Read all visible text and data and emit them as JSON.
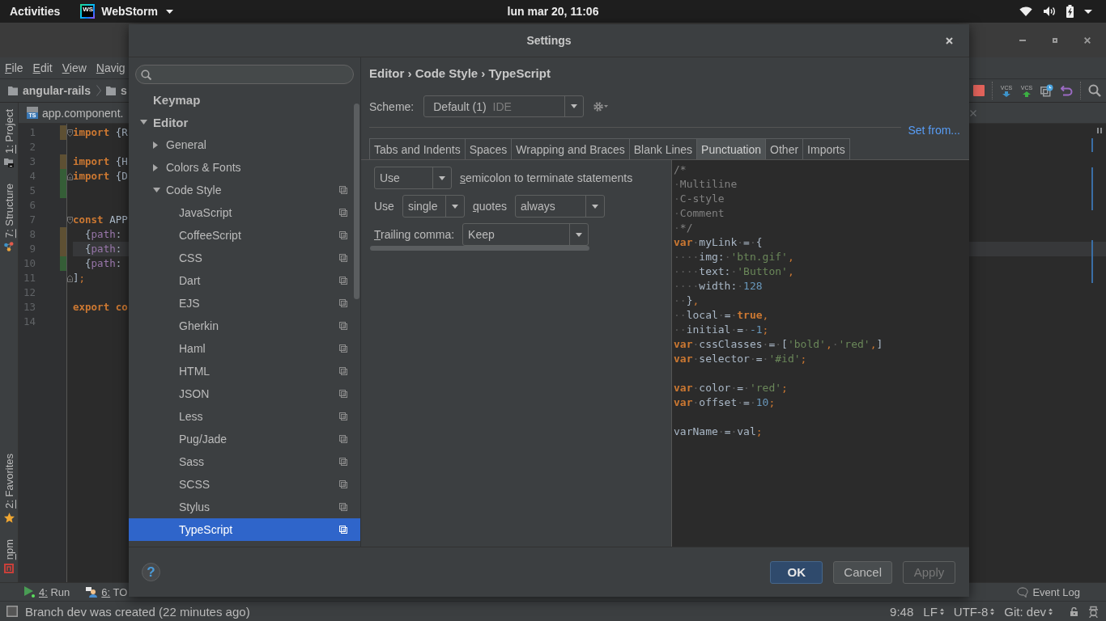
{
  "top_bar": {
    "activities": "Activities",
    "app": {
      "logo": "WS",
      "name": "WebStorm"
    },
    "clock": "lun mar 20, 11:06"
  },
  "ide": {
    "menu": [
      "File",
      "Edit",
      "View",
      "Navig"
    ],
    "breadcrumb": [
      "angular-rails",
      "s"
    ],
    "toolbar": [
      {
        "kind": "stop"
      },
      {
        "kind": "vcs-update",
        "label": "VCS"
      },
      {
        "kind": "vcs-commit",
        "label": "VCS"
      },
      {
        "kind": "history"
      },
      {
        "kind": "revert"
      },
      {
        "kind": "search"
      }
    ],
    "tool_windows_left": [
      {
        "label": "1: Project",
        "kind": "project"
      },
      {
        "label": "7: Structure",
        "kind": "structure"
      }
    ],
    "tool_windows_left_bottom": [
      {
        "label": "2: Favorites",
        "kind": "favorites"
      },
      {
        "label": "npm",
        "kind": "npm"
      }
    ],
    "editor_tab": {
      "icon_text": "TS",
      "label": "app.component."
    },
    "editor_lines": [
      {
        "number": "1",
        "current": false,
        "modified": true,
        "added": false,
        "fold_start": true,
        "fold_end": false,
        "tokens": [
          {
            "kind": "keyword",
            "text": "import"
          },
          {
            "kind": "plain",
            "text": " {R"
          }
        ]
      },
      {
        "number": "2",
        "current": false,
        "modified": false,
        "added": false,
        "fold_start": false,
        "fold_end": false
      },
      {
        "number": "3",
        "current": false,
        "modified": true,
        "added": false,
        "fold_start": false,
        "fold_end": false,
        "tokens": [
          {
            "kind": "keyword",
            "text": "import"
          },
          {
            "kind": "plain",
            "text": " {H"
          }
        ]
      },
      {
        "number": "4",
        "current": false,
        "modified": false,
        "added": true,
        "fold_start": false,
        "fold_end": true,
        "tokens": [
          {
            "kind": "keyword",
            "text": "import"
          },
          {
            "kind": "plain",
            "text": " {D"
          }
        ]
      },
      {
        "number": "5",
        "current": false,
        "modified": false,
        "added": true,
        "fold_start": false,
        "fold_end": false
      },
      {
        "number": "6",
        "current": false,
        "modified": false,
        "added": false,
        "fold_start": false,
        "fold_end": false
      },
      {
        "number": "7",
        "current": false,
        "modified": false,
        "added": false,
        "fold_start": true,
        "fold_end": false,
        "tokens": [
          {
            "kind": "keyword",
            "text": "const"
          },
          {
            "kind": "plain",
            "text": " APP"
          }
        ]
      },
      {
        "number": "8",
        "current": false,
        "modified": true,
        "added": false,
        "fold_start": false,
        "fold_end": false,
        "tokens": [
          {
            "kind": "plain",
            "text": "  {"
          },
          {
            "kind": "property",
            "text": "path"
          },
          {
            "kind": "plain",
            "text": ":"
          }
        ]
      },
      {
        "number": "9",
        "current": true,
        "modified": true,
        "added": false,
        "fold_start": false,
        "fold_end": false,
        "tokens": [
          {
            "kind": "plain",
            "text": "  {"
          },
          {
            "kind": "property",
            "text": "path"
          },
          {
            "kind": "plain",
            "text": ":"
          }
        ]
      },
      {
        "number": "10",
        "current": false,
        "modified": false,
        "added": true,
        "fold_start": false,
        "fold_end": false,
        "tokens": [
          {
            "kind": "plain",
            "text": "  {"
          },
          {
            "kind": "property",
            "text": "path"
          },
          {
            "kind": "plain",
            "text": ":"
          }
        ]
      },
      {
        "number": "11",
        "current": false,
        "modified": false,
        "added": false,
        "fold_start": false,
        "fold_end": true,
        "tokens": [
          {
            "kind": "plain",
            "text": "]"
          },
          {
            "kind": "punct",
            "text": ";"
          }
        ]
      },
      {
        "number": "12",
        "current": false,
        "modified": false,
        "added": false,
        "fold_start": false,
        "fold_end": false
      },
      {
        "number": "13",
        "current": false,
        "modified": false,
        "added": false,
        "fold_start": false,
        "fold_end": false,
        "tokens": [
          {
            "kind": "keyword",
            "text": "export"
          },
          {
            "kind": "keyword",
            "text": " co"
          }
        ]
      },
      {
        "number": "14",
        "current": false,
        "modified": false,
        "added": false,
        "fold_start": false,
        "fold_end": false
      }
    ],
    "tool_windows_bottom": [
      {
        "label": "4: Run",
        "kind": "run"
      },
      {
        "label": "6: TO",
        "kind": "todo"
      }
    ],
    "event_log": "Event Log",
    "status": {
      "message": "Branch dev was created (22 minutes ago)",
      "items": [
        {
          "text": "9:48",
          "menu": false
        },
        {
          "text": "LF",
          "menu": true
        },
        {
          "text": "UTF-8",
          "menu": true
        },
        {
          "text": "Git: dev",
          "menu": true
        }
      ]
    }
  },
  "settings": {
    "title": "Settings",
    "tree": [
      {
        "label": "Keymap",
        "selected": false,
        "project_setting": false
      },
      {
        "label": "Editor",
        "selected": false,
        "project_setting": false,
        "expanded": true,
        "children": [
          {
            "label": "General",
            "selected": false,
            "project_setting": false,
            "expanded": false
          },
          {
            "label": "Colors & Fonts",
            "selected": false,
            "project_setting": false,
            "expanded": false
          },
          {
            "label": "Code Style",
            "selected": false,
            "project_setting": true,
            "expanded": true,
            "children": [
              {
                "label": "JavaScript",
                "selected": false,
                "project_setting": true
              },
              {
                "label": "CoffeeScript",
                "selected": false,
                "project_setting": true
              },
              {
                "label": "CSS",
                "selected": false,
                "project_setting": true
              },
              {
                "label": "Dart",
                "selected": false,
                "project_setting": true
              },
              {
                "label": "EJS",
                "selected": false,
                "project_setting": true
              },
              {
                "label": "Gherkin",
                "selected": false,
                "project_setting": true
              },
              {
                "label": "Haml",
                "selected": false,
                "project_setting": true
              },
              {
                "label": "HTML",
                "selected": false,
                "project_setting": true
              },
              {
                "label": "JSON",
                "selected": false,
                "project_setting": true
              },
              {
                "label": "Less",
                "selected": false,
                "project_setting": true
              },
              {
                "label": "Pug/Jade",
                "selected": false,
                "project_setting": true
              },
              {
                "label": "Sass",
                "selected": false,
                "project_setting": true
              },
              {
                "label": "SCSS",
                "selected": false,
                "project_setting": true
              },
              {
                "label": "Stylus",
                "selected": false,
                "project_setting": true
              },
              {
                "label": "TypeScript",
                "selected": true,
                "project_setting": true
              }
            ]
          }
        ]
      }
    ],
    "breadcrumb": "Editor › Code Style › TypeScript",
    "scheme": {
      "label": "Scheme:",
      "value": "Default (1)",
      "tag": "IDE"
    },
    "set_from": "Set from...",
    "tabs": [
      {
        "label": "Tabs and Indents",
        "selected": false
      },
      {
        "label": "Spaces",
        "selected": false
      },
      {
        "label": "Wrapping and Braces",
        "selected": false
      },
      {
        "label": "Blank Lines",
        "selected": false
      },
      {
        "label": "Punctuation",
        "selected": true
      },
      {
        "label": "Other",
        "selected": false
      },
      {
        "label": "Imports",
        "selected": false
      }
    ],
    "options": [
      [
        {
          "kind": "dropdown",
          "value": "Use"
        },
        {
          "kind": "label",
          "text": "semicolon to terminate statements",
          "mnemonic": true
        }
      ],
      [
        {
          "kind": "label",
          "text": "Use",
          "mnemonic": false
        },
        {
          "kind": "dropdown",
          "value": "single"
        },
        {
          "kind": "label",
          "text": "quotes",
          "mnemonic": true
        },
        {
          "kind": "dropdown",
          "value": "always"
        }
      ],
      [
        {
          "kind": "label",
          "text": "Trailing comma:",
          "mnemonic": true
        },
        {
          "kind": "dropdown",
          "value": "Keep"
        }
      ]
    ],
    "preview": [
      [
        [
          {
            "kind": "comment",
            "text": "/*"
          }
        ],
        [
          {
            "kind": "ws",
            "text": "·"
          },
          {
            "kind": "comment",
            "text": "Multiline"
          }
        ],
        [
          {
            "kind": "ws",
            "text": "·"
          },
          {
            "kind": "comment",
            "text": "C-style"
          }
        ],
        [
          {
            "kind": "ws",
            "text": "·"
          },
          {
            "kind": "comment",
            "text": "Comment"
          }
        ],
        [
          {
            "kind": "ws",
            "text": "·"
          },
          {
            "kind": "comment",
            "text": "*/"
          }
        ],
        [
          {
            "kind": "keyword",
            "text": "var"
          },
          {
            "kind": "ws",
            "text": "·"
          },
          {
            "kind": "ident",
            "text": "myLink"
          },
          {
            "kind": "ws",
            "text": "·"
          },
          {
            "kind": "ident",
            "text": "="
          },
          {
            "kind": "ws",
            "text": "·"
          },
          {
            "kind": "ident",
            "text": "{"
          }
        ],
        [
          {
            "kind": "ws",
            "text": "····"
          },
          {
            "kind": "ident",
            "text": "img:"
          },
          {
            "kind": "ws",
            "text": "·"
          },
          {
            "kind": "string",
            "text": "'btn.gif'"
          },
          {
            "kind": "punct",
            "text": ","
          }
        ],
        [
          {
            "kind": "ws",
            "text": "····"
          },
          {
            "kind": "ident",
            "text": "text:"
          },
          {
            "kind": "ws",
            "text": "·"
          },
          {
            "kind": "string",
            "text": "'Button'"
          },
          {
            "kind": "punct",
            "text": ","
          }
        ],
        [
          {
            "kind": "ws",
            "text": "····"
          },
          {
            "kind": "ident",
            "text": "width:"
          },
          {
            "kind": "ws",
            "text": "·"
          },
          {
            "kind": "number",
            "text": "128"
          }
        ],
        [
          {
            "kind": "ws",
            "text": "··"
          },
          {
            "kind": "ident",
            "text": "}"
          },
          {
            "kind": "punct",
            "text": ","
          }
        ],
        [
          {
            "kind": "ws",
            "text": "··"
          },
          {
            "kind": "ident",
            "text": "local"
          },
          {
            "kind": "ws",
            "text": "·"
          },
          {
            "kind": "ident",
            "text": "="
          },
          {
            "kind": "ws",
            "text": "·"
          },
          {
            "kind": "keyword",
            "text": "true"
          },
          {
            "kind": "punct",
            "text": ","
          }
        ],
        [
          {
            "kind": "ws",
            "text": "··"
          },
          {
            "kind": "ident",
            "text": "initial"
          },
          {
            "kind": "ws",
            "text": "·"
          },
          {
            "kind": "ident",
            "text": "="
          },
          {
            "kind": "ws",
            "text": "·"
          },
          {
            "kind": "number",
            "text": "-1"
          },
          {
            "kind": "punct",
            "text": ";"
          }
        ],
        [
          {
            "kind": "keyword",
            "text": "var"
          },
          {
            "kind": "ws",
            "text": "·"
          },
          {
            "kind": "ident",
            "text": "cssClasses"
          },
          {
            "kind": "ws",
            "text": "·"
          },
          {
            "kind": "ident",
            "text": "="
          },
          {
            "kind": "ws",
            "text": "·"
          },
          {
            "kind": "ident",
            "text": "["
          },
          {
            "kind": "string",
            "text": "'bold'"
          },
          {
            "kind": "punct",
            "text": ","
          },
          {
            "kind": "ws",
            "text": "·"
          },
          {
            "kind": "string",
            "text": "'red'"
          },
          {
            "kind": "punct",
            "text": ","
          },
          {
            "kind": "ident",
            "text": "]"
          }
        ],
        [
          {
            "kind": "keyword",
            "text": "var"
          },
          {
            "kind": "ws",
            "text": "·"
          },
          {
            "kind": "ident",
            "text": "selector"
          },
          {
            "kind": "ws",
            "text": "·"
          },
          {
            "kind": "ident",
            "text": "="
          },
          {
            "kind": "ws",
            "text": "·"
          },
          {
            "kind": "string",
            "text": "'#id'"
          },
          {
            "kind": "punct",
            "text": ";"
          }
        ]
      ],
      [
        [
          {
            "kind": "keyword",
            "text": "var"
          },
          {
            "kind": "ws",
            "text": "·"
          },
          {
            "kind": "ident",
            "text": "color"
          },
          {
            "kind": "ws",
            "text": "·"
          },
          {
            "kind": "ident",
            "text": "="
          },
          {
            "kind": "ws",
            "text": "·"
          },
          {
            "kind": "string",
            "text": "'red'"
          },
          {
            "kind": "punct",
            "text": ";"
          }
        ],
        [
          {
            "kind": "keyword",
            "text": "var"
          },
          {
            "kind": "ws",
            "text": "·"
          },
          {
            "kind": "ident",
            "text": "offset"
          },
          {
            "kind": "ws",
            "text": "·"
          },
          {
            "kind": "ident",
            "text": "="
          },
          {
            "kind": "ws",
            "text": "·"
          },
          {
            "kind": "number",
            "text": "10"
          },
          {
            "kind": "punct",
            "text": ";"
          }
        ]
      ],
      [
        [
          {
            "kind": "ident",
            "text": "varName"
          },
          {
            "kind": "ws",
            "text": "·"
          },
          {
            "kind": "ident",
            "text": "="
          },
          {
            "kind": "ws",
            "text": "·"
          },
          {
            "kind": "ident",
            "text": "val"
          },
          {
            "kind": "punct",
            "text": ";"
          }
        ]
      ]
    ],
    "help": "?",
    "buttons": [
      {
        "label": "OK",
        "kind": "default",
        "disabled": false
      },
      {
        "label": "Cancel",
        "kind": "normal",
        "disabled": false
      },
      {
        "label": "Apply",
        "kind": "normal",
        "disabled": true
      }
    ]
  }
}
